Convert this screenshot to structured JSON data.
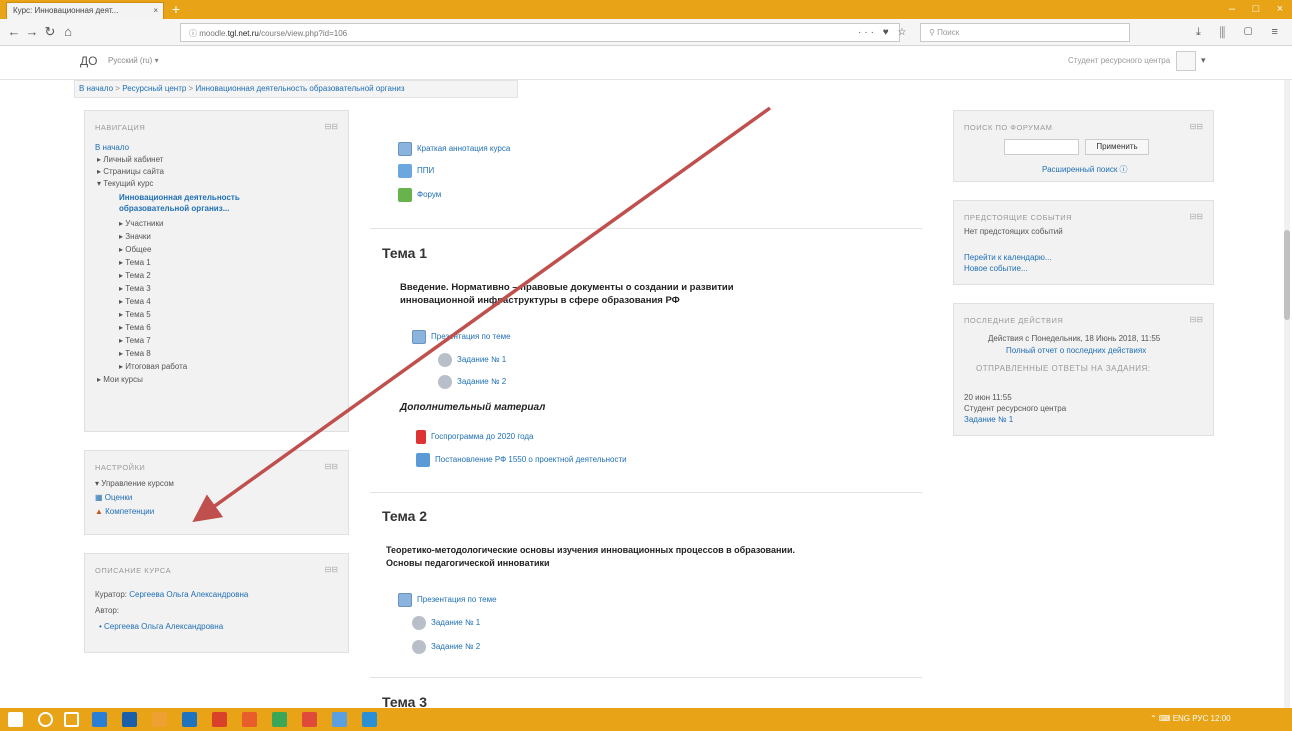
{
  "browser": {
    "tab_title": "Курс: Инновационная деят...",
    "tab_close": "×",
    "new_tab": "+",
    "url_prefix": "moodle.",
    "url_domain": "tgl.net.ru",
    "url_rest": "/course/view.php?id=106",
    "url_actions": "··· ♥ ☆",
    "search_placeholder": "Поиск",
    "toolbar_icons": "⤓ ⫼ ▢ ≡",
    "minimize": "–",
    "maximize": "□",
    "close": "×"
  },
  "header": {
    "brand": "ДО",
    "language": "Русский (ru) ▾",
    "user": "Студент ресурсного центра",
    "user_caret": "▾"
  },
  "breadcrumb": {
    "home": "В начало",
    "sep1": " > ",
    "item1": "Ресурсный центр",
    "sep2": " > ",
    "item2": "Инновационная деятельность образовательной организ"
  },
  "navigation": {
    "title": "НАВИГАЦИЯ",
    "controls": "⊟⊟",
    "items": [
      {
        "label": "В начало"
      },
      {
        "label": "▸ Личный кабинет"
      },
      {
        "label": "▸ Страницы сайта"
      },
      {
        "label": "▾ Текущий курс"
      },
      {
        "label": "Инновационная деятельность"
      },
      {
        "label": "образовательной организ..."
      },
      {
        "label": "▸ Участники"
      },
      {
        "label": "▸ Значки"
      },
      {
        "label": "▸ Общее"
      },
      {
        "label": "▸ Тема 1"
      },
      {
        "label": "▸ Тема 2"
      },
      {
        "label": "▸ Тема 3"
      },
      {
        "label": "▸ Тема 4"
      },
      {
        "label": "▸ Тема 5"
      },
      {
        "label": "▸ Тема 6"
      },
      {
        "label": "▸ Тема 7"
      },
      {
        "label": "▸ Тема 8"
      },
      {
        "label": "▸ Итоговая работа"
      },
      {
        "label": "▸ Мои курсы"
      }
    ]
  },
  "settings": {
    "title": "НАСТРОЙКИ",
    "controls": "⊟⊟",
    "manage": "▾ Управление курсом",
    "grades": "Оценки",
    "competencies": "Компетенции"
  },
  "course_desc": {
    "title": "ОПИСАНИЕ КУРСА",
    "controls": "⊟⊟",
    "curator_label": "Куратор: ",
    "curator": "Сергеева Ольга Александровна",
    "author_label": "Автор:",
    "author": "• Сергеева Ольга Александровна"
  },
  "general": {
    "items": [
      "Краткая аннотация курса",
      "ППИ",
      "Форум"
    ]
  },
  "topic1": {
    "title": "Тема 1",
    "desc_line1": "Введение. Нормативно – правовые документы  о создании и развитии",
    "desc_line2": "инновационной инфраструктуры в сфере образования РФ",
    "presentation": "Презентация по теме",
    "task1": "Задание № 1",
    "task2": "Задание № 2",
    "extra_title": "Дополнительный материал",
    "extra1": "Госпрограмма до 2020 года",
    "extra2": "Постановление РФ 1550 о проектной деятельности"
  },
  "topic2": {
    "title": "Тема 2",
    "desc_line1": "Теоретико-методологические основы изучения инновационных процессов в образовании.",
    "desc_line2": "Основы педагогической инноватики",
    "presentation": "Презентация по теме",
    "task1": "Задание № 1",
    "task2": "Задание № 2"
  },
  "topic3": {
    "title": "Тема 3"
  },
  "forum_search": {
    "title": "ПОИСК ПО ФОРУМАМ",
    "controls": "⊟⊟",
    "button": "Применить",
    "advanced": "Расширенный поиск ⓘ"
  },
  "upcoming": {
    "title": "ПРЕДСТОЯЩИЕ СОБЫТИЯ",
    "controls": "⊟⊟",
    "none": "Нет предстоящих событий",
    "calendar": "Перейти к календарю...",
    "new_event": "Новое событие..."
  },
  "recent": {
    "title": "ПОСЛЕДНИЕ ДЕЙСТВИЯ",
    "controls": "⊟⊟",
    "since": "Действия с Понедельник, 18 Июнь 2018, 11:55",
    "full_report": "Полный отчет о последних действиях",
    "submitted": "ОТПРАВЛЕННЫЕ ОТВЕТЫ НА ЗАДАНИЯ:",
    "date": "20 июн 11:55",
    "user": "Студент ресурсного центра",
    "task": "Задание № 1"
  },
  "taskbar": {
    "tray": "⌃ ⌨ ENG РУС  12:00"
  },
  "colors": {
    "accent": "#e8a316",
    "link": "#1f6fb5",
    "arrow": "#c0504d"
  }
}
